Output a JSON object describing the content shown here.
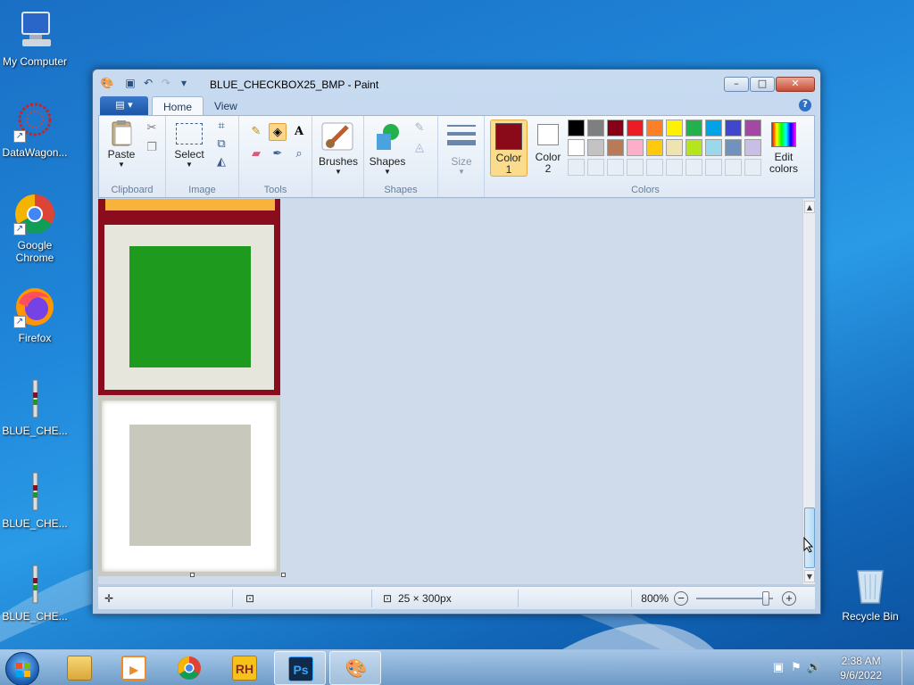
{
  "desktop": {
    "icons": [
      {
        "label": "My Computer"
      },
      {
        "label": "DataWagon..."
      },
      {
        "label": "Google Chrome"
      },
      {
        "label": "Firefox"
      },
      {
        "label": "BLUE_CHE..."
      },
      {
        "label": "BLUE_CHE..."
      },
      {
        "label": "BLUE_CHE..."
      },
      {
        "label": "Recycle Bin"
      }
    ]
  },
  "window": {
    "title": "BLUE_CHECKBOX25_BMP - Paint",
    "controls": {
      "minimize": "–",
      "maximize": "□",
      "close": "✕"
    }
  },
  "ribbon": {
    "tabs": [
      {
        "label": "Home"
      },
      {
        "label": "View"
      }
    ],
    "file_menu_glyph": "▤ ▾",
    "help": "?",
    "groups": {
      "clipboard": {
        "label": "Clipboard",
        "paste": "Paste"
      },
      "image": {
        "label": "Image",
        "select": "Select"
      },
      "tools": {
        "label": "Tools"
      },
      "brushes": {
        "label": "Brushes"
      },
      "shapes": {
        "label": "Shapes",
        "button": "Shapes"
      },
      "size": {
        "label": "Size"
      },
      "colors": {
        "label": "Colors",
        "color1_line1": "Color",
        "color1_line2": "1",
        "color2_line1": "Color",
        "color2_line2": "2",
        "edit_line1": "Edit",
        "edit_line2": "colors",
        "color1_value": "#8a0a1a",
        "color2_value": "#ffffff",
        "palette_row1": [
          "#000000",
          "#7f7f7f",
          "#880015",
          "#ed1c24",
          "#ff7f27",
          "#fff200",
          "#22b14c",
          "#00a2e8",
          "#3f48cc",
          "#a349a4"
        ],
        "palette_row2": [
          "#ffffff",
          "#c3c3c3",
          "#b97a57",
          "#ffaec9",
          "#ffc90e",
          "#efe4b0",
          "#b5e61d",
          "#99d9ea",
          "#7092be",
          "#c8bfe7"
        ]
      }
    }
  },
  "canvas": {
    "image_colors": {
      "top_strip": "#f7b33a",
      "frame_border": "#8b0c1c",
      "green_fill": "#1e9a1e",
      "frame_bg": "#e9e8df",
      "gray_fill": "#c9c8bd"
    }
  },
  "statusbar": {
    "dimensions": "25 × 300px",
    "zoom": "800%"
  },
  "taskbar": {
    "clock_time": "2:38 AM",
    "clock_date": "9/6/2022",
    "apps": [
      {
        "name": "RH"
      },
      {
        "name": "Ps"
      }
    ]
  }
}
